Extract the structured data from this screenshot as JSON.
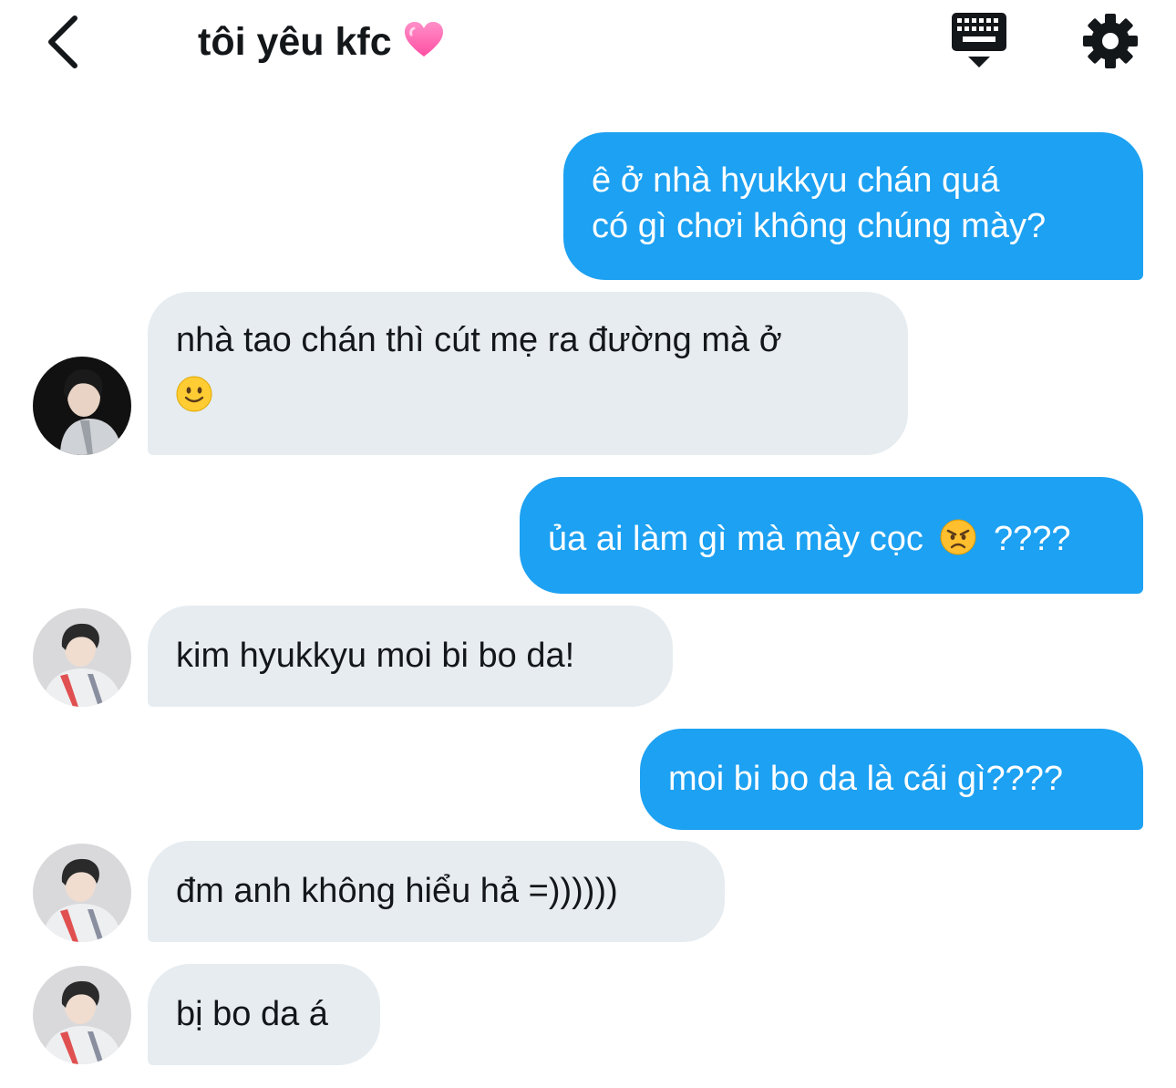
{
  "header": {
    "title": "tôi yêu kfc",
    "title_emoji": "heart-icon"
  },
  "colors": {
    "outgoing_bubble": "#1da1f2",
    "incoming_bubble": "#e6ecf0",
    "text": "#14171a"
  },
  "messages": [
    {
      "sender": "me",
      "lines": [
        "ê ở nhà hyukkyu chán quá",
        "có gì chơi không chúng mày?"
      ]
    },
    {
      "sender": "them",
      "lines": [
        "nhà tao chán thì cút mẹ ra đường mà ở"
      ],
      "emoji": "slightly-smiling-face-icon"
    },
    {
      "sender": "me",
      "text_before": "ủa ai làm gì mà mày cọc",
      "emoji": "angry-face-icon",
      "text_after": "????"
    },
    {
      "sender": "them",
      "lines": [
        "kim hyukkyu moi bi bo da!"
      ]
    },
    {
      "sender": "me",
      "lines": [
        "moi bi bo da là cái gì????"
      ]
    },
    {
      "sender": "them",
      "lines": [
        "đm anh không hiểu hả =))))))"
      ]
    },
    {
      "sender": "them",
      "lines": [
        "bị bo da á"
      ]
    }
  ]
}
